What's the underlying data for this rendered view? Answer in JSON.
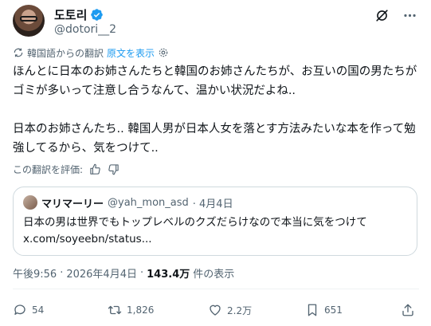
{
  "author": {
    "display_name": "도토리",
    "handle": "@dotori__2",
    "verified_color": "#1d9bf0"
  },
  "header_icons": [
    "grok-icon",
    "more-icon"
  ],
  "translation": {
    "label": "韓国語からの翻訳",
    "show_original": "原文を表示"
  },
  "tweet": {
    "paragraphs": [
      "ほんとに日本のお姉さんたちと韓国のお姉さんたちが、お互いの国の男たちがゴミが多いって注意し合うなんて、温かい状況だよね..",
      "日本のお姉さんたち.. 韓国人男が日本人女を落とす方法みたいな本を作って勉強してるから、気をつけて.."
    ]
  },
  "rate_translation": {
    "label": "この翻訳を評価:"
  },
  "quote": {
    "display_name": "マリマーリー",
    "handle": "@yah_mon_asd",
    "date": "· 4月4日",
    "text_line1": "日本の男は世界でもトップレベルのクズだらけなので本当に気をつけて",
    "text_line2": "x.com/soyeebn/status..."
  },
  "meta": {
    "time": "午後9:56",
    "sep": "·",
    "date": "2026年4月4日",
    "sep2": "·",
    "views": "143.4万",
    "views_label": "件の表示"
  },
  "actions": {
    "replies": "54",
    "reposts": "1,826",
    "likes": "2.2万",
    "bookmarks": "651"
  },
  "colors": {
    "text": "#0f1419",
    "secondary": "#536471",
    "link": "#1d9bf0",
    "border": "#cfd9de"
  }
}
